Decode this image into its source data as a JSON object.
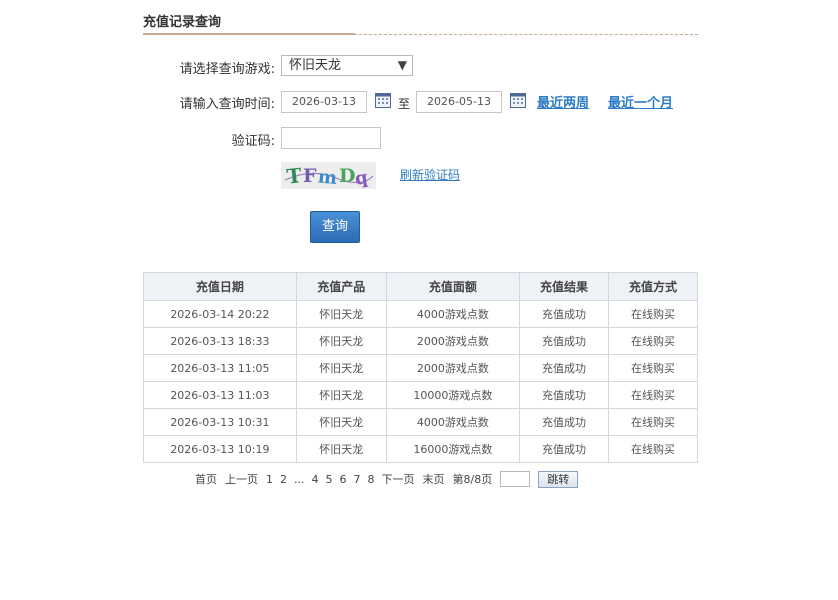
{
  "page_title": "充值记录查询",
  "form": {
    "game_label": "请选择查询游戏:",
    "game_selected": "怀旧天龙",
    "time_label": "请输入查询时间:",
    "date_start": "2026-03-13",
    "date_to": "至",
    "date_end": "2026-05-13",
    "quick_two_weeks": "最近两周",
    "quick_one_month": "最近一个月",
    "code_label": "验证码:",
    "captcha_text": "TFmDq",
    "refresh_captcha": "刷新验证码",
    "query_button": "查询"
  },
  "table": {
    "headers": [
      "充值日期",
      "充值产品",
      "充值面额",
      "充值结果",
      "充值方式"
    ],
    "rows": [
      [
        "2026-03-14 20:22",
        "怀旧天龙",
        "4000游戏点数",
        "充值成功",
        "在线购买"
      ],
      [
        "2026-03-13 18:33",
        "怀旧天龙",
        "2000游戏点数",
        "充值成功",
        "在线购买"
      ],
      [
        "2026-03-13 11:05",
        "怀旧天龙",
        "2000游戏点数",
        "充值成功",
        "在线购买"
      ],
      [
        "2026-03-13 11:03",
        "怀旧天龙",
        "10000游戏点数",
        "充值成功",
        "在线购买"
      ],
      [
        "2026-03-13 10:31",
        "怀旧天龙",
        "4000游戏点数",
        "充值成功",
        "在线购买"
      ],
      [
        "2026-03-13 10:19",
        "怀旧天龙",
        "16000游戏点数",
        "充值成功",
        "在线购买"
      ]
    ]
  },
  "pager": {
    "first": "首页",
    "prev": "上一页",
    "pages": [
      "1",
      "2",
      "...",
      "4",
      "5",
      "6",
      "7",
      "8"
    ],
    "next": "下一页",
    "last": "末页",
    "status": "第8/8页",
    "jump": "跳转"
  }
}
